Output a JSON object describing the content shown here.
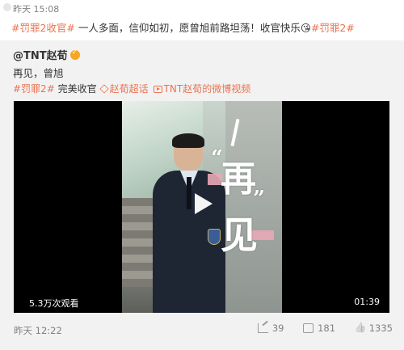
{
  "top_meta": {
    "time": "昨天 15:08"
  },
  "post": {
    "tag1": "#罚罪2收官#",
    "text": " 一人多面，信仰如初，愿曾旭前路坦荡！收官快乐",
    "emoji": "😘",
    "tag2": "#罚罪2#"
  },
  "repost": {
    "author": "@TNT赵荀",
    "line2": "再见，曾旭",
    "tag": "#罚罪2#",
    "text": " 完美收官",
    "super_topic": "赵荀超话",
    "video_link": "TNT赵荀的微博视频"
  },
  "video": {
    "calligraphy_1": "再",
    "calligraphy_2": "见",
    "quote_open": "“",
    "quote_close": "”",
    "views": "5.3万次观看",
    "duration": "01:39"
  },
  "footer": {
    "time": "昨天 12:22",
    "share_count": "39",
    "comment_count": "181",
    "like_count": "1335"
  },
  "colors": {
    "accent": "#eb7350",
    "repost_bg": "#f2f2f2",
    "meta_text": "#808080"
  }
}
